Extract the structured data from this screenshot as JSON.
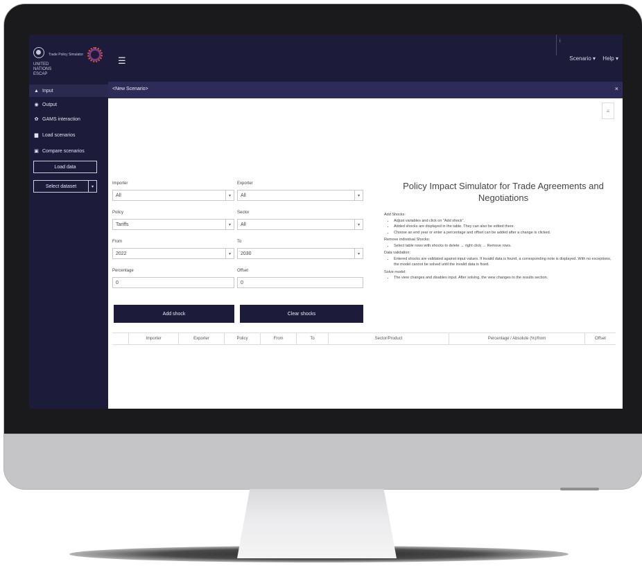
{
  "brand": {
    "org_abbrev": "UNITED\nNATIONS\nESCAP",
    "product_name": "Trade Policy Simulator"
  },
  "header": {
    "menu_icon": "hamburger-icon",
    "top_small": "i",
    "scenario_menu": "Scenario ▾",
    "help_menu": "Help ▾"
  },
  "sidebar": {
    "items": [
      {
        "label": "Input",
        "icon": "▲"
      },
      {
        "label": "Output",
        "icon": "◉"
      },
      {
        "label": "GAMS interaction",
        "icon": "✿"
      },
      {
        "label": "Load scenarios",
        "icon": "▆"
      },
      {
        "label": "Compare scenarios",
        "icon": "▣"
      }
    ],
    "load_data_label": "Load data",
    "select_dataset_label": "Select dataset",
    "select_dataset_caret": "▾"
  },
  "tab": {
    "title": "<New Scenario>",
    "close": "×"
  },
  "form": {
    "importer": {
      "label": "Importer",
      "value": "All"
    },
    "exporter": {
      "label": "Exporter",
      "value": "All"
    },
    "policy": {
      "label": "Policy",
      "value": "Tariffs"
    },
    "sector": {
      "label": "Sector",
      "value": "All"
    },
    "from": {
      "label": "From",
      "value": "2022"
    },
    "to": {
      "label": "To",
      "value": "2030"
    },
    "percentage": {
      "label": "Percentage",
      "value": "0"
    },
    "offset": {
      "label": "Offset",
      "value": "0"
    },
    "add_shock": "Add shock",
    "clear_shocks": "Clear shocks",
    "arrow": "▾"
  },
  "help": {
    "title": "Policy Impact Simulator for Trade Agreements and Negotiations",
    "sections": [
      {
        "heading": "Add Shocks:",
        "bullets": [
          "Adjust variables and click on \"Add shock\".",
          "Added shocks are displayed in the table. They can also be edited there.",
          "Choose an end year or enter a percentage and offset can be added after a change is clicked."
        ]
      },
      {
        "heading": "Remove individual Shocks:",
        "bullets": [
          "Select table rows with shocks to delete → right click → Remove rows."
        ]
      },
      {
        "heading": "Data validation:",
        "bullets": [
          "Entered shocks are validated against input values. If invalid data is found, a corresponding note is displayed. With no exceptions, the model cannot be solved until the invalid data is fixed."
        ]
      },
      {
        "heading": "Solve model:",
        "bullets": [
          "The view changes and disables input. After solving, the view changes to the results section."
        ]
      }
    ]
  },
  "table": {
    "columns": [
      "",
      "Importer",
      "Exporter",
      "Policy",
      "From",
      "To",
      "Sector/Product",
      "Percentage / Absolute (%)/from",
      "Offset"
    ]
  }
}
